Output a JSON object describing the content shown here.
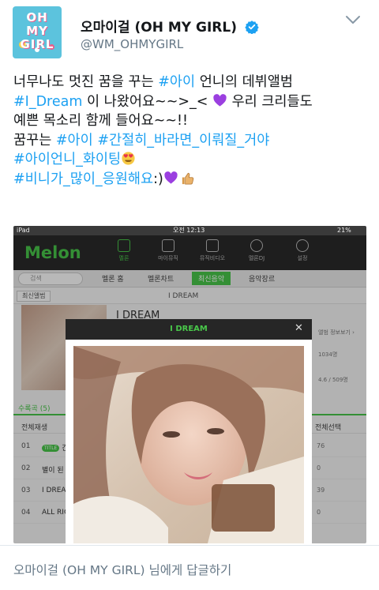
{
  "tweet": {
    "display_name": "오마이걸 (OH MY GIRL)",
    "handle": "@WM_OHMYGIRL",
    "avatar_logo_text": "OH MY GIRL",
    "text": {
      "l1_a": "너무나도 멋진 꿈을 꾸는 ",
      "l1_tag": "#아이",
      "l1_b": " 언니의 데뷔앨범",
      "l2_tag": "#I_Dream",
      "l2_b": " 이 나왔어요~~>_< ",
      "l2_c": " 우리 크리들도",
      "l3": "예쁜 목소리 함께 들어요~~!!",
      "l4_a": "꿈꾸는 ",
      "l4_tag1": "#아이",
      "l4_tag2": "#간절히_바라면_이뤄질_거야",
      "l5_tag": "#아이언니_화이팅",
      "l6_tag": "#비니가_많이_응원해요",
      "l6_b": ":)"
    },
    "emojis": [
      "purple-heart",
      "heart-eyes",
      "purple-heart",
      "thumbs-up"
    ]
  },
  "screenshot": {
    "status_left": "iPad",
    "status_time": "오전 12:13",
    "status_battery": "21%",
    "app_logo": "Melon",
    "nav": [
      "멜론",
      "마이뮤직",
      "뮤직비디오",
      "멜론DJ",
      "설정"
    ],
    "search_placeholder": "검색",
    "tabs": [
      "멜론 홈",
      "멜론차트",
      "최신음악",
      "음악장르"
    ],
    "back_label": "최신앨범",
    "page_title": "I DREAM",
    "album_title_bg": "I DREAM",
    "info_link": "앨범 정보보기",
    "like_count": "1034명",
    "rating": "4.6 / 509명",
    "list_tab": "수록곡 (5)",
    "play_all": "전체재생",
    "select_all": "전체선택",
    "tracks": [
      {
        "num": "01",
        "title_badge": "TITLE",
        "name": "간",
        "right": "76"
      },
      {
        "num": "02",
        "title_badge": "",
        "name": "별이 된",
        "right": "0"
      },
      {
        "num": "03",
        "title_badge": "",
        "name": "I DREAM",
        "right": "39"
      },
      {
        "num": "04",
        "title_badge": "",
        "name": "ALL RIG",
        "right": "0"
      }
    ],
    "popup_title": "I DREAM",
    "popup_close": "✕"
  },
  "reply_bar": {
    "label": "오마이걸 (OH MY GIRL) 님에게 답글하기"
  },
  "colors": {
    "link_blue": "#1da1f2",
    "melon_green": "#49c74a",
    "muted_gray": "#657786"
  }
}
